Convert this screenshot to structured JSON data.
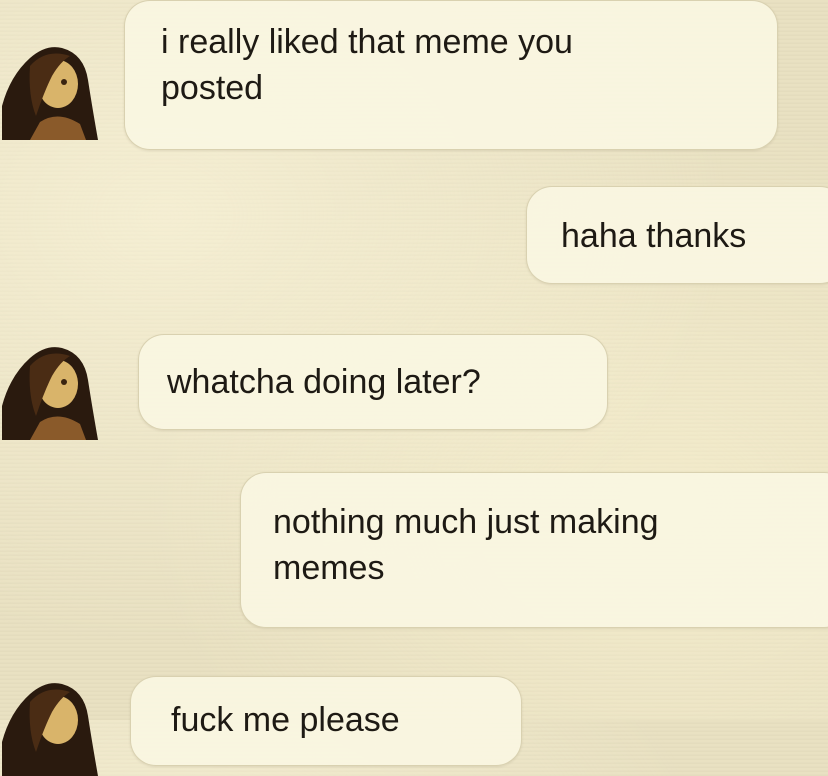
{
  "conversation": {
    "messages": [
      {
        "sender": "contact",
        "text": "i really liked that meme you\nposted"
      },
      {
        "sender": "me",
        "text": "haha thanks"
      },
      {
        "sender": "contact",
        "text": "whatcha doing later?"
      },
      {
        "sender": "me",
        "text": "nothing much just making\nmemes"
      },
      {
        "sender": "contact",
        "text": "fuck me please"
      }
    ]
  },
  "colors": {
    "background": "#e9e1c2",
    "bubble": "#faf6e2",
    "text": "#1e1a14"
  },
  "icons": {
    "contact_avatar": "profile-photo-icon"
  }
}
